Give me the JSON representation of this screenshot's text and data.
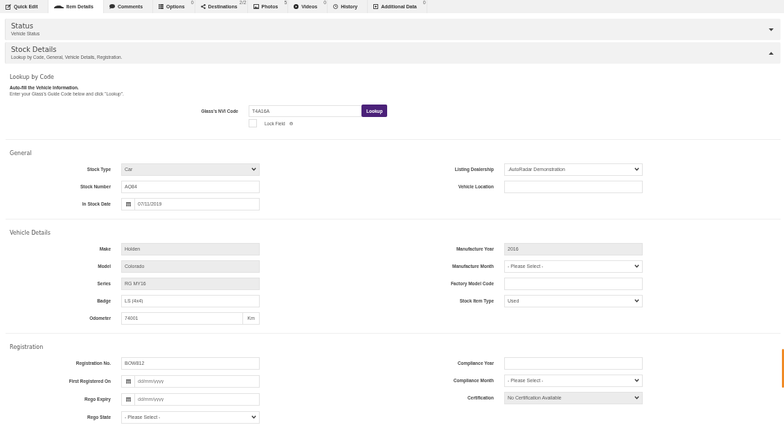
{
  "tabs": [
    {
      "label": "Quick Edit",
      "selected": false
    },
    {
      "label": "Item Details",
      "selected": true
    },
    {
      "label": "Comments",
      "selected": false
    },
    {
      "label": "Options",
      "badge": "0",
      "selected": false
    },
    {
      "label": "Destinations",
      "badge": "2/2",
      "selected": false
    },
    {
      "label": "Photos",
      "badge": "5",
      "selected": false
    },
    {
      "label": "Videos",
      "badge": "0",
      "selected": false
    },
    {
      "label": "History",
      "selected": false
    },
    {
      "label": "Additional Data",
      "badge": "0",
      "selected": false
    }
  ],
  "panels": [
    {
      "title": "Status",
      "subtitle": "Vehicle Status",
      "expanded": false
    },
    {
      "title": "Stock Details",
      "subtitle": "Lookup by Code, General, Vehicle Details, Registration.",
      "expanded": true
    }
  ],
  "lookup": {
    "title": "Lookup by Code",
    "intro_bold": "Auto-fill the Vehicle Information.",
    "intro": "Enter your Glass's Guide Code below and click \"Lookup\".",
    "label": "Glass's NVI Code",
    "value": "T4A16A",
    "button": "Lookup",
    "lock_label": "Lock Field",
    "lock_checked": false
  },
  "sections": [
    {
      "title": "General",
      "left": [
        {
          "label": "Stock Type",
          "kind": "select",
          "value": "Car",
          "disabled": true
        },
        {
          "label": "Stock Number",
          "kind": "text",
          "value": "AQ84",
          "disabled": false
        },
        {
          "label": "In Stock Date",
          "kind": "date",
          "value": "07/11/2019",
          "disabled": false
        }
      ],
      "right": [
        {
          "label": "Listing Dealership",
          "kind": "select",
          "value": ".AutoRadar Demonstration",
          "disabled": false
        },
        {
          "label": "Vehicle Location",
          "kind": "text",
          "disabled": false
        }
      ]
    },
    {
      "title": "Vehicle Details",
      "left": [
        {
          "label": "Make",
          "kind": "text",
          "value": "Holden",
          "disabled": true
        },
        {
          "label": "Model",
          "kind": "text",
          "value": "Colorado",
          "disabled": true
        },
        {
          "label": "Series",
          "kind": "text",
          "value": "RG MY16",
          "disabled": true
        },
        {
          "label": "Badge",
          "kind": "text",
          "value": "LS (4x4)",
          "disabled": false
        },
        {
          "label": "Odometer",
          "kind": "unit",
          "value": "74001",
          "unit": "Km",
          "disabled": false
        }
      ],
      "right": [
        {
          "label": "Manufacture Year",
          "kind": "text",
          "value": "2016",
          "disabled": true
        },
        {
          "label": "Manufacture Month",
          "kind": "select",
          "value": "- Please Select -",
          "disabled": false
        },
        {
          "label": "Factory Model Code",
          "kind": "text",
          "disabled": false
        },
        {
          "label": "Stock Item Type",
          "kind": "select",
          "value": "Used",
          "disabled": false
        }
      ]
    },
    {
      "title": "Registration",
      "left": [
        {
          "label": "Registration No.",
          "kind": "text",
          "value": "BOW812",
          "disabled": false
        },
        {
          "label": "First Registered On",
          "kind": "date",
          "placeholder": "dd/mm/yyyy",
          "disabled": false
        },
        {
          "label": "Rego Expiry",
          "kind": "date",
          "placeholder": "dd/mm/yyyy",
          "disabled": false
        },
        {
          "label": "Rego State",
          "kind": "select",
          "value": "- Please Select -",
          "disabled": false
        }
      ],
      "right": [
        {
          "label": "Compliance Year",
          "kind": "text",
          "disabled": false
        },
        {
          "label": "Compliance Month",
          "kind": "select",
          "value": "- Please Select -",
          "disabled": false
        },
        {
          "label": "Certification",
          "kind": "select",
          "value": "No Certification Available",
          "disabled": true
        }
      ]
    }
  ]
}
